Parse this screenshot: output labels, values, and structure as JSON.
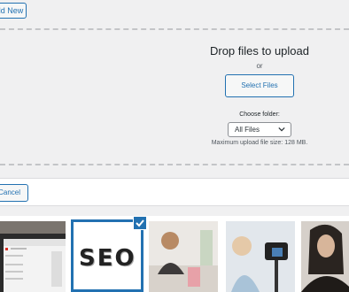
{
  "header": {
    "add_new_label": "dd New"
  },
  "uploader": {
    "drop_title": "Drop files to upload",
    "or_text": "or",
    "select_files_label": "Select Files",
    "folder_label": "Choose folder:",
    "folder_selected": "All Files",
    "max_size_text": "Maximum upload file size: 128 MB."
  },
  "toolbar": {
    "cancel_label": "Cancel"
  },
  "media": {
    "seo_letters": [
      "S",
      "E",
      "O"
    ],
    "items": [
      {
        "name": "laptop-screenshot"
      },
      {
        "name": "seo-letters-image",
        "selected": true
      },
      {
        "name": "woman-at-desk-image"
      },
      {
        "name": "woman-with-camera-image"
      },
      {
        "name": "woman-portrait-image"
      }
    ]
  },
  "colors": {
    "accent": "#2271b1",
    "panel_bg": "#f0f0f1",
    "border": "#c3c4c7"
  }
}
